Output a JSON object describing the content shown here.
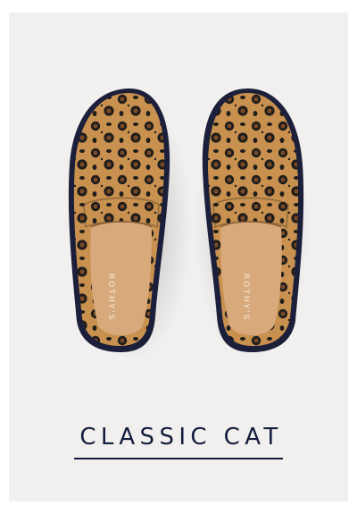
{
  "product": {
    "title": "CLASSIC CAT",
    "insole_brand": "ROTHY'S",
    "image_alt": "Pair of leopard print loafers, top view"
  },
  "colors": {
    "card_background": "#f1f0ee",
    "title_color": "#141d3f",
    "leopard_base": "#c9914f",
    "leopard_spot": "#1f1d1b",
    "leopard_rosette": "#7a4a27",
    "insole": "#d7a97b",
    "sole": "#1c1f3a"
  }
}
